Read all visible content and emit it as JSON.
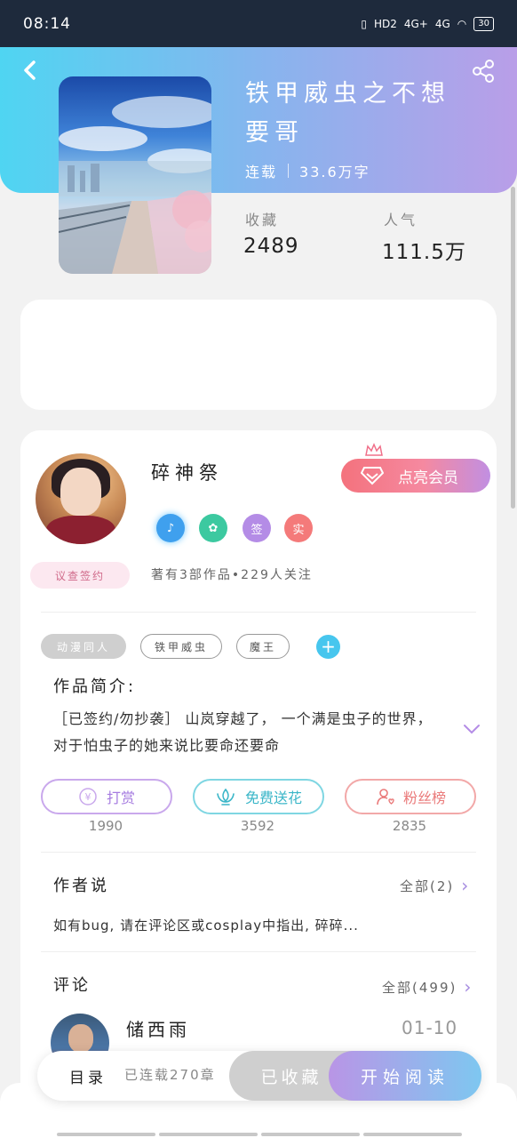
{
  "status_bar": {
    "time": "08:14",
    "network_1": "HD2",
    "network_2": "4G+",
    "network_3": "4G",
    "battery": "30"
  },
  "book": {
    "title": "铁甲威虫之不想要哥",
    "status": "连载",
    "word_count": "33.6万字",
    "collect_label": "收藏",
    "collect_value": "2489",
    "popularity_label": "人气",
    "popularity_value": "111.5万"
  },
  "author": {
    "name": "碎神祭",
    "vip_button": "点亮会员",
    "badges": [
      {
        "label": "♪",
        "color": "#3fa0ee"
      },
      {
        "label": "✿",
        "color": "#3cc9a0"
      },
      {
        "label": "签",
        "color": "#b48ce6"
      },
      {
        "label": "实",
        "color": "#f47a7a"
      }
    ],
    "stats": "著有3部作品•229人关注",
    "signed_tag": "议查签约"
  },
  "tags": [
    "动漫同人",
    "铁甲威虫",
    "魔王"
  ],
  "intro": {
    "title": "作品简介:",
    "text": "［已签约/勿抄袭］ 山岚穿越了， 一个满是虫子的世界， 对于怕虫子的她来说比要命还要命"
  },
  "actions": [
    {
      "label": "打赏",
      "count": "1990",
      "color": "#b48ce6",
      "icon": "yen-icon"
    },
    {
      "label": "免费送花",
      "count": "3592",
      "color": "#3ec6d8",
      "icon": "flower-icon"
    },
    {
      "label": "粉丝榜",
      "count": "2835",
      "color": "#f08a8a",
      "icon": "fans-icon"
    }
  ],
  "author_says": {
    "title": "作者说",
    "more": "全部(2)",
    "text": "如有bug, 请在评论区或cosplay中指出, 碎碎..."
  },
  "comments": {
    "title": "评论",
    "more": "全部(499)",
    "first": {
      "name": "储西雨",
      "date": "01-10"
    }
  },
  "bottom_bar": {
    "toc": "目录",
    "chapters": "已连载270章",
    "collected": "已收藏",
    "read": "开始阅读"
  }
}
